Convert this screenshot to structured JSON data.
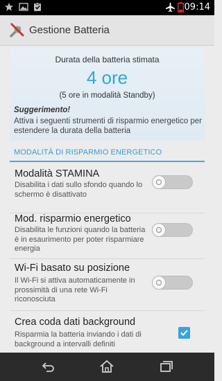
{
  "status_bar": {
    "time": "09:14",
    "left_icons": [
      "star-icon",
      "image-icon",
      "clipboard-check-icon"
    ],
    "right_icons": [
      "airplane-icon",
      "battery-low-icon"
    ]
  },
  "action_bar": {
    "title": "Gestione Batteria",
    "icon": "tools-icon"
  },
  "estimate": {
    "heading": "Durata della batteria stimata",
    "value": "4 ore",
    "standby": "(5 ore in modalità Standby)",
    "tip_title": "Suggerimento!",
    "tip_text": "Attiva i seguenti strumenti di risparmio energetico per estendere la durata della batteria"
  },
  "section": {
    "title": "MODALITÀ DI RISPARMIO ENERGETICO"
  },
  "settings": [
    {
      "title": "Modalità STAMINA",
      "subtitle": "Disabilita i dati sullo sfondo quando lo schermo è disattivato",
      "control": "toggle",
      "on": false
    },
    {
      "title": "Mod. risparmio energetico",
      "subtitle": "Disabilita le funzioni quando la batteria è in esaurimento per poter risparmiare energia",
      "control": "toggle",
      "on": false
    },
    {
      "title": "Wi-Fi basato su posizione",
      "subtitle": "Il Wi-Fi si attiva automaticamente in prossimità di una rete Wi-Fi riconosciuta",
      "control": "toggle",
      "on": false
    },
    {
      "title": "Crea coda dati background",
      "subtitle": "Risparmia la batteria inviando i dati di background a intervalli definiti",
      "control": "checkbox",
      "checked": true
    }
  ],
  "nav_bar": {
    "buttons": [
      "back-icon",
      "home-icon",
      "recent-apps-icon"
    ]
  },
  "colors": {
    "accent": "#2ea8dd",
    "status_bar": "#000000",
    "nav_bar": "#2b2b2b",
    "background": "#ececec"
  }
}
